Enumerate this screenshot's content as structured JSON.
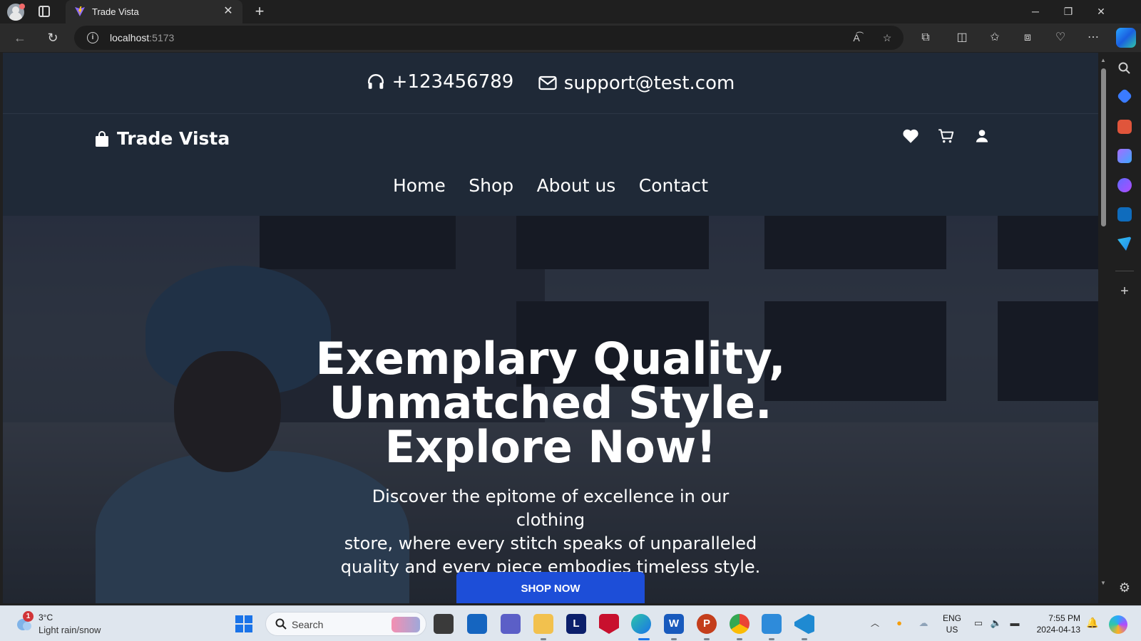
{
  "browser": {
    "tab_title": "Trade Vista",
    "url_host": "localhost",
    "url_port": ":5173",
    "icons": [
      "profile-avatar",
      "vertical-tabs",
      "new-tab",
      "back",
      "refresh",
      "read-aloud",
      "favorite-star",
      "extensions",
      "split-screen",
      "favorites",
      "collections",
      "browser-essentials",
      "more-options",
      "copilot"
    ]
  },
  "site": {
    "phone": "+123456789",
    "email": "support@test.com",
    "brand": "Trade Vista",
    "nav": [
      {
        "label": "Home"
      },
      {
        "label": "Shop"
      },
      {
        "label": "About us"
      },
      {
        "label": "Contact"
      }
    ],
    "hero": {
      "title_line1": "Exemplary Quality,",
      "title_line2": "Unmatched Style.",
      "title_line3": "Explore Now!",
      "desc_line1": "Discover the epitome of excellence in our clothing",
      "desc_line2": "store, where every stitch speaks of unparalleled",
      "desc_line3": "quality and every piece embodies timeless style.",
      "cta": "SHOP NOW"
    },
    "colors": {
      "header_bg": "#1f2937",
      "cta": "#1d4ed8",
      "text": "#ffffff"
    }
  },
  "taskbar": {
    "weather_alerts": "1",
    "weather_temp": "3°C",
    "weather_desc": "Light rain/snow",
    "search_placeholder": "Search",
    "apps": [
      {
        "name": "file-explorer-task-view"
      },
      {
        "name": "microsoft-store"
      },
      {
        "name": "teams"
      },
      {
        "name": "file-explorer"
      },
      {
        "name": "lexicon-app",
        "letter": "L"
      },
      {
        "name": "mcafee"
      },
      {
        "name": "edge"
      },
      {
        "name": "word",
        "letter": "W"
      },
      {
        "name": "powerpoint",
        "letter": "P"
      },
      {
        "name": "chrome"
      },
      {
        "name": "notepad"
      },
      {
        "name": "vscode"
      }
    ],
    "lang_line1": "ENG",
    "lang_line2": "US",
    "time": "7:55 PM",
    "date": "2024-04-13"
  }
}
